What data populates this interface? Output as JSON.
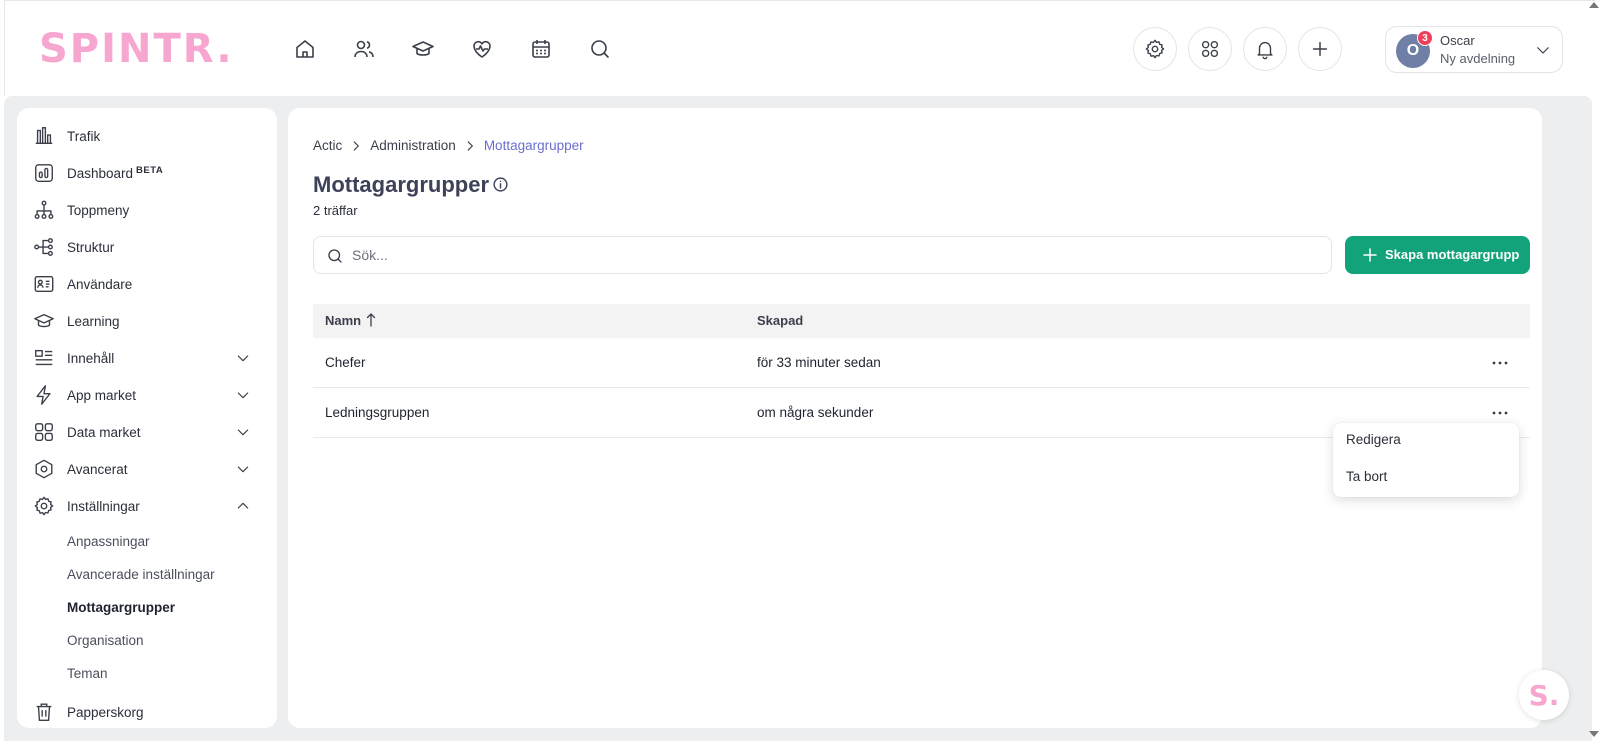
{
  "brand": {
    "logo_text": "SPINTR.",
    "logo_color": "#f6a6cf",
    "accent": "#12a37a",
    "link_color": "#6b6fd0"
  },
  "topnav": {
    "icons": [
      "home-icon",
      "users-icon",
      "graduation-cap-icon",
      "heart-pulse-icon",
      "calendar-icon",
      "search-icon"
    ]
  },
  "header_actions": {
    "icons": [
      "gear-icon",
      "apps-grid-icon",
      "bell-icon",
      "plus-icon"
    ]
  },
  "user": {
    "initial": "O",
    "badge_count": "3",
    "name": "Oscar",
    "department": "Ny avdelning"
  },
  "sidebar": {
    "items": [
      {
        "label": "Trafik",
        "icon": "bar-chart-icon"
      },
      {
        "label": "Dashboard",
        "badge": "BETA",
        "icon": "dashboard-icon"
      },
      {
        "label": "Toppmeny",
        "icon": "hierarchy-icon"
      },
      {
        "label": "Struktur",
        "icon": "structure-icon"
      },
      {
        "label": "Användare",
        "icon": "id-card-icon"
      },
      {
        "label": "Learning",
        "icon": "graduation-cap-icon"
      },
      {
        "label": "Innehåll",
        "icon": "content-list-icon",
        "expandable": true
      },
      {
        "label": "App market",
        "icon": "lightning-icon",
        "expandable": true
      },
      {
        "label": "Data market",
        "icon": "grid-icon",
        "expandable": true
      },
      {
        "label": "Avancerat",
        "icon": "hexagon-icon",
        "expandable": true
      },
      {
        "label": "Inställningar",
        "icon": "gear-icon",
        "expandable": true,
        "expanded": true
      },
      {
        "label": "Papperskorg",
        "icon": "trash-icon"
      }
    ],
    "settings_subitems": [
      {
        "label": "Anpassningar"
      },
      {
        "label": "Avancerade inställningar"
      },
      {
        "label": "Mottagargrupper",
        "active": true
      },
      {
        "label": "Organisation"
      },
      {
        "label": "Teman"
      }
    ]
  },
  "breadcrumb": [
    "Actic",
    "Administration",
    "Mottagargrupper"
  ],
  "page": {
    "title": "Mottagargrupper",
    "hits": "2 träffar",
    "search_placeholder": "Sök...",
    "create_button": "Skapa mottagargrupp"
  },
  "table": {
    "columns": [
      "Namn",
      "Skapad"
    ],
    "sort": {
      "column": "Namn",
      "direction": "ascending"
    },
    "rows": [
      {
        "name": "Chefer",
        "created": "för 33 minuter sedan"
      },
      {
        "name": "Ledningsgruppen",
        "created": "om några sekunder"
      }
    ]
  },
  "row_menu": {
    "items": [
      "Redigera",
      "Ta bort"
    ]
  },
  "help_bubble": {
    "text": "S."
  }
}
